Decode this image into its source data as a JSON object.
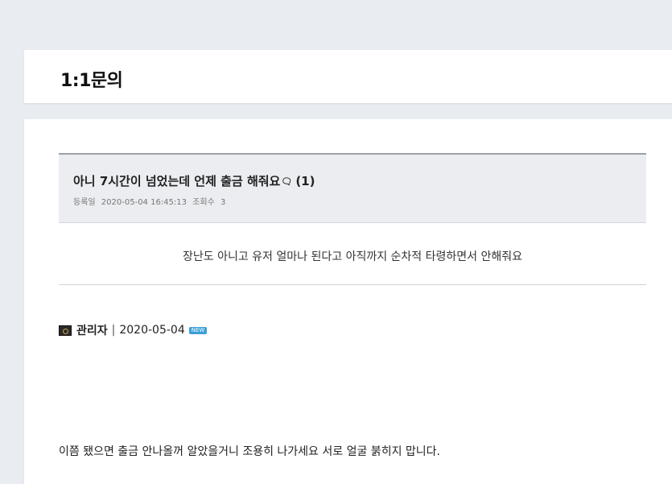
{
  "page": {
    "title": "1:1문의"
  },
  "post": {
    "title": "아니 7시간이 넘었는데 언제 출금 해줘요",
    "comment_icon": "speech-bubble-icon",
    "comment_count": "(1)",
    "meta": {
      "date_label": "등록일",
      "date": "2020-05-04 16:45:13",
      "views_label": "조회수",
      "views": "3"
    },
    "body": "장난도 아니고 유저 얼마나 된다고 아직까지 순차적 타령하면서 안해줘요"
  },
  "reply": {
    "author": "관리자",
    "separator": "|",
    "date": "2020-05-04",
    "badge": "NEW",
    "body": "이쯤 됐으면 출금 안나올꺼 알았을거니 조용히 나가세요 서로 얼굴 붉히지 맙니다."
  },
  "colors": {
    "background": "#e9ecf0",
    "card": "#ffffff",
    "header_box": "#ebedf0",
    "badge": "#3aa0d8"
  }
}
